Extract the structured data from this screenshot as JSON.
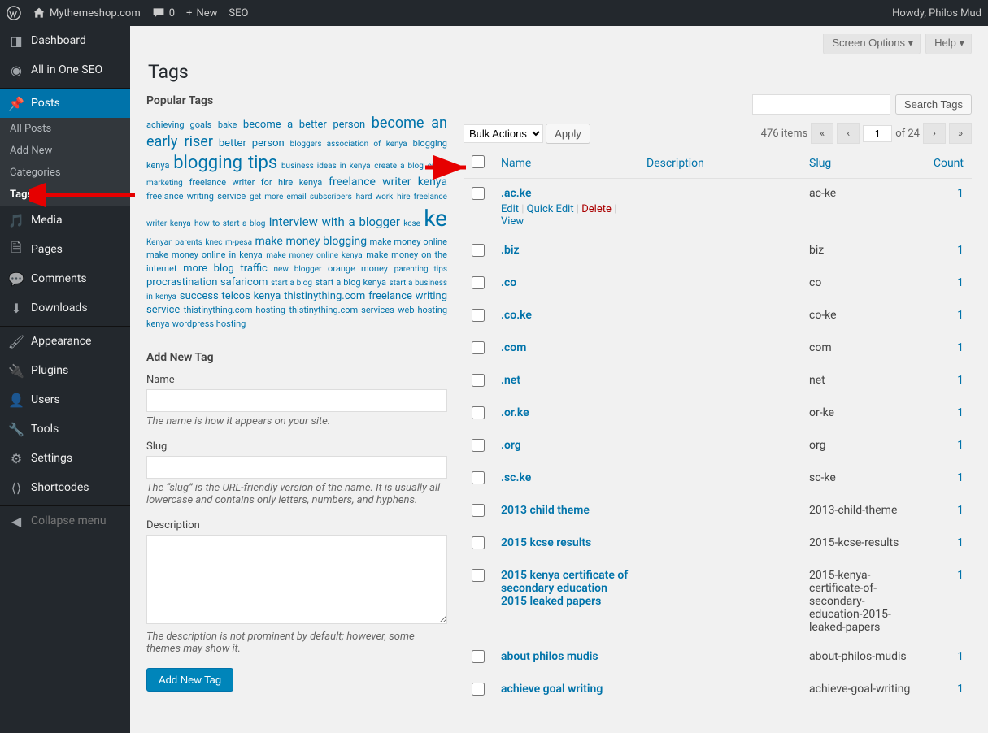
{
  "adminbar": {
    "site_name": "Mythemeshop.com",
    "comments_count": "0",
    "new_label": "New",
    "seo_label": "SEO",
    "howdy": "Howdy, Philos Mud"
  },
  "sidebar": {
    "dashboard": "Dashboard",
    "aioseo": "All in One SEO",
    "posts": "Posts",
    "posts_sub": {
      "all": "All Posts",
      "add": "Add New",
      "cats": "Categories",
      "tags": "Tags"
    },
    "media": "Media",
    "pages": "Pages",
    "comments": "Comments",
    "downloads": "Downloads",
    "appearance": "Appearance",
    "plugins": "Plugins",
    "users": "Users",
    "tools": "Tools",
    "settings": "Settings",
    "shortcodes": "Shortcodes",
    "collapse": "Collapse menu"
  },
  "screen_meta": {
    "screen_options": "Screen Options",
    "help": "Help"
  },
  "page_title": "Tags",
  "popular_heading": "Popular Tags",
  "popular_tags": [
    {
      "t": "achieving goals",
      "s": 11
    },
    {
      "t": "bake",
      "s": 11
    },
    {
      "t": "become a better person",
      "s": 13
    },
    {
      "t": "become an early riser",
      "s": 18
    },
    {
      "t": "better person",
      "s": 13
    },
    {
      "t": "bloggers association of kenya",
      "s": 10
    },
    {
      "t": "blogging kenya",
      "s": 11
    },
    {
      "t": "blogging tips",
      "s": 22
    },
    {
      "t": "business ideas in kenya",
      "s": 10
    },
    {
      "t": "create a blog",
      "s": 10
    },
    {
      "t": "email marketing",
      "s": 10
    },
    {
      "t": "freelance writer for hire kenya",
      "s": 11
    },
    {
      "t": "freelance writer kenya",
      "s": 14
    },
    {
      "t": "freelance writing service",
      "s": 11
    },
    {
      "t": "get more email subscribers",
      "s": 10
    },
    {
      "t": "hard work",
      "s": 10
    },
    {
      "t": "hire freelance writer kenya",
      "s": 10
    },
    {
      "t": "how to start a blog",
      "s": 10
    },
    {
      "t": "interview with a blogger",
      "s": 15
    },
    {
      "t": "kcse",
      "s": 10
    },
    {
      "t": "ke",
      "s": 28
    },
    {
      "t": "Kenyan parents",
      "s": 10
    },
    {
      "t": "knec",
      "s": 10
    },
    {
      "t": "m-pesa",
      "s": 10
    },
    {
      "t": "make money blogging",
      "s": 14
    },
    {
      "t": "make money online",
      "s": 11
    },
    {
      "t": "make money online in kenya",
      "s": 11
    },
    {
      "t": "make money online kenya",
      "s": 10
    },
    {
      "t": "make money on the internet",
      "s": 11
    },
    {
      "t": "more blog traffic",
      "s": 13
    },
    {
      "t": "new blogger",
      "s": 10
    },
    {
      "t": "orange money",
      "s": 11
    },
    {
      "t": "parenting tips",
      "s": 10
    },
    {
      "t": "procrastination",
      "s": 13
    },
    {
      "t": "safaricom",
      "s": 13
    },
    {
      "t": "start a blog",
      "s": 10
    },
    {
      "t": "start a blog kenya",
      "s": 11
    },
    {
      "t": "start a business in kenya",
      "s": 10
    },
    {
      "t": "success",
      "s": 13
    },
    {
      "t": "telcos kenya",
      "s": 13
    },
    {
      "t": "thistinything.com freelance writing service",
      "s": 13
    },
    {
      "t": "thistinything.com hosting",
      "s": 11
    },
    {
      "t": "thistinything.com services",
      "s": 11
    },
    {
      "t": "web hosting kenya",
      "s": 11
    },
    {
      "t": "wordpress hosting",
      "s": 11
    }
  ],
  "form": {
    "heading": "Add New Tag",
    "name_label": "Name",
    "name_desc": "The name is how it appears on your site.",
    "slug_label": "Slug",
    "slug_desc": "The “slug” is the URL-friendly version of the name. It is usually all lowercase and contains only letters, numbers, and hyphens.",
    "desc_label": "Description",
    "desc_desc": "The description is not prominent by default; however, some themes may show it.",
    "submit": "Add New Tag"
  },
  "search": {
    "button": "Search Tags"
  },
  "bulk": {
    "default_option": "Bulk Actions",
    "apply": "Apply"
  },
  "pagination": {
    "items": "476 items",
    "current": "1",
    "of_total": "of 24"
  },
  "columns": {
    "name": "Name",
    "description": "Description",
    "slug": "Slug",
    "count": "Count"
  },
  "row_actions": {
    "edit": "Edit",
    "quick": "Quick Edit",
    "delete": "Delete",
    "view": "View"
  },
  "rows": [
    {
      "name": ".ac.ke",
      "slug": "ac-ke",
      "count": "1",
      "show_actions": true
    },
    {
      "name": ".biz",
      "slug": "biz",
      "count": "1"
    },
    {
      "name": ".co",
      "slug": "co",
      "count": "1"
    },
    {
      "name": ".co.ke",
      "slug": "co-ke",
      "count": "1"
    },
    {
      "name": ".com",
      "slug": "com",
      "count": "1"
    },
    {
      "name": ".net",
      "slug": "net",
      "count": "1"
    },
    {
      "name": ".or.ke",
      "slug": "or-ke",
      "count": "1"
    },
    {
      "name": ".org",
      "slug": "org",
      "count": "1"
    },
    {
      "name": ".sc.ke",
      "slug": "sc-ke",
      "count": "1"
    },
    {
      "name": "2013 child theme",
      "slug": "2013-child-theme",
      "count": "1"
    },
    {
      "name": "2015 kcse results",
      "slug": "2015-kcse-results",
      "count": "1"
    },
    {
      "name": "2015 kenya certificate of secondary education 2015 leaked papers",
      "slug": "2015-kenya-certificate-of-secondary-education-2015-leaked-papers",
      "count": "1"
    },
    {
      "name": "about philos mudis",
      "slug": "about-philos-mudis",
      "count": "1"
    },
    {
      "name": "achieve goal writing",
      "slug": "achieve-goal-writing",
      "count": "1"
    }
  ]
}
